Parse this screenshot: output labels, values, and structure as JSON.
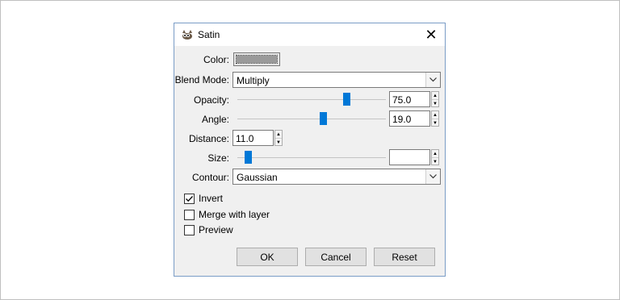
{
  "dialog": {
    "title": "Satin",
    "close_glyph": "✕",
    "icon": "gimp-icon"
  },
  "fields": {
    "color": {
      "label": "Color:",
      "swatch_color": "#9a9a9a"
    },
    "blend_mode": {
      "label": "Blend Mode:",
      "value": "Multiply"
    },
    "opacity": {
      "label": "Opacity:",
      "value": "75.0",
      "level": 0.75
    },
    "angle": {
      "label": "Angle:",
      "value": "19.0",
      "level": 0.58
    },
    "distance": {
      "label": "Distance:",
      "value": "11.0"
    },
    "size": {
      "label": "Size:",
      "value": "",
      "level": 0.05
    },
    "contour": {
      "label": "Contour:",
      "value": "Gaussian"
    }
  },
  "checkboxes": [
    {
      "label": "Invert",
      "checked": true
    },
    {
      "label": "Merge with layer",
      "checked": false
    },
    {
      "label": "Preview",
      "checked": false
    }
  ],
  "buttons": {
    "ok": "OK",
    "cancel": "Cancel",
    "reset": "Reset"
  },
  "colors": {
    "accent": "#0078d7",
    "dialog_bg": "#f0f0f0"
  }
}
